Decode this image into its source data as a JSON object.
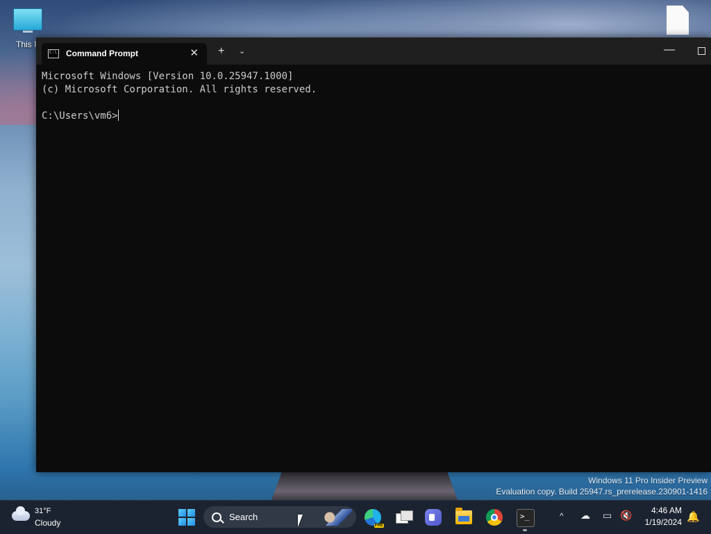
{
  "desktop": {
    "this_pc_label": "This P",
    "watermark": {
      "line1": "Windows 11 Pro Insider Preview",
      "line2": "Evaluation copy. Build 25947.rs_prerelease.230901-1416"
    }
  },
  "window": {
    "tab_title": "Command Prompt",
    "tab_close": "✕",
    "new_tab": "+",
    "tab_dropdown": "⌄",
    "minimize": "—"
  },
  "console": {
    "lines": [
      "Microsoft Windows [Version 10.0.25947.1000]",
      "(c) Microsoft Corporation. All rights reserved.",
      "",
      "C:\\Users\\vm6>"
    ]
  },
  "taskbar": {
    "weather": {
      "temp": "31°F",
      "condition": "Cloudy"
    },
    "search_label": "Search",
    "tray": {
      "chevron": "^",
      "time": "4:46 AM",
      "date": "1/19/2024"
    },
    "apps": [
      "edge-icon",
      "task-view-icon",
      "meet-icon",
      "file-explorer-icon",
      "chrome-icon",
      "terminal-icon"
    ]
  }
}
